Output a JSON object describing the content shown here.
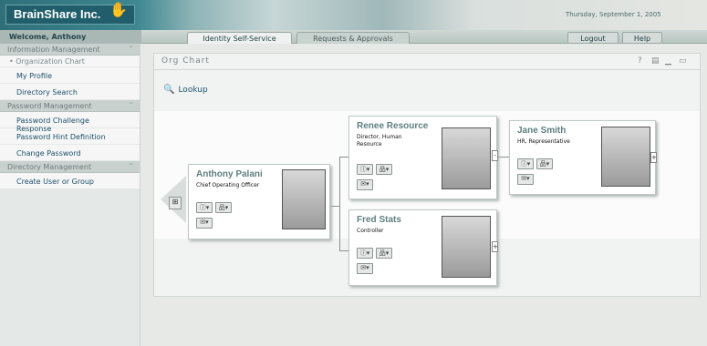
{
  "brand": {
    "name": "BrainShare Inc.",
    "date": "Thursday, September 1, 2005"
  },
  "header": {
    "welcome": "Welcome, Anthony",
    "tabs": [
      "Identity Self-Service",
      "Requests & Approvals"
    ],
    "logout": "Logout",
    "help": "Help"
  },
  "sidebar": {
    "sections": [
      {
        "title": "Information Management",
        "current": "• Organization Chart",
        "items": [
          "My Profile",
          "Directory Search"
        ]
      },
      {
        "title": "Password Management",
        "items": [
          "Password Challenge Response",
          "Password Hint Definition",
          "Change Password"
        ]
      },
      {
        "title": "Directory Management",
        "items": [
          "Create User or Group"
        ]
      }
    ]
  },
  "panel": {
    "title": "Org Chart",
    "lookup": "Lookup"
  },
  "people": [
    {
      "name": "Anthony Palani",
      "title": "Chief Operating Officer"
    },
    {
      "name": "Renee Resource",
      "title": "Director, Human Resource"
    },
    {
      "name": "Fred Stats",
      "title": "Controller"
    },
    {
      "name": "Jane Smith",
      "title": "HR, Representative"
    }
  ],
  "colors": {
    "brand": "#1f5e6a",
    "link": "#1d4f6a",
    "name": "#5f7f80"
  }
}
